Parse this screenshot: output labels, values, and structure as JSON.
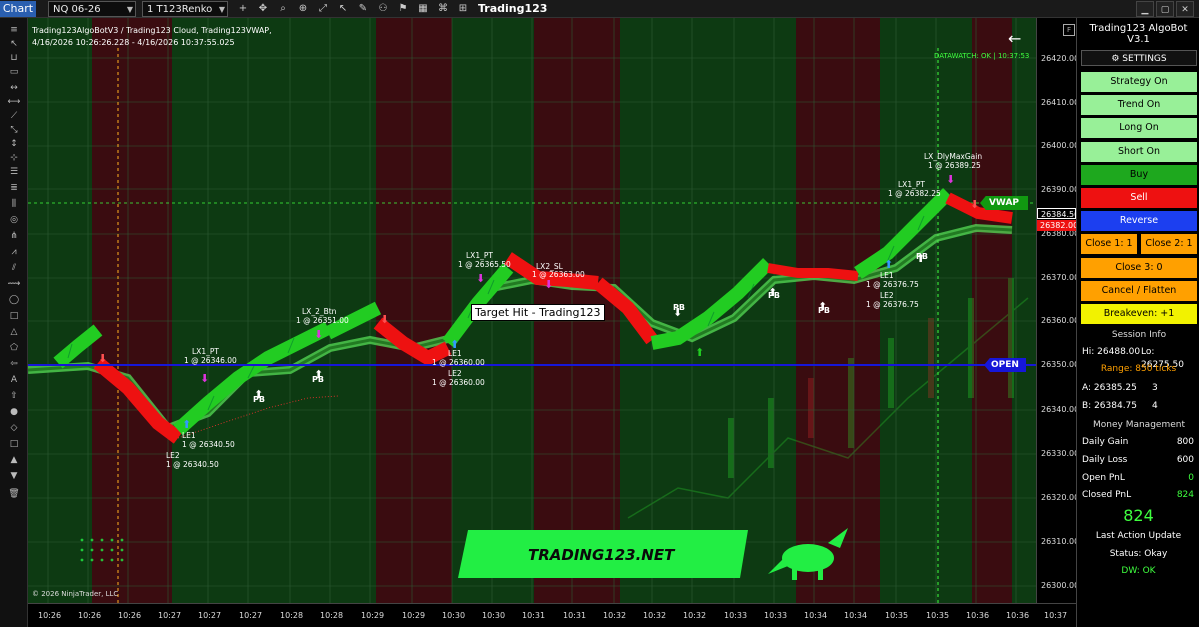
{
  "toolbar": {
    "chart_label": "Chart",
    "instrument": "NQ 06-26",
    "bar_type": "1 T123Renko T...",
    "window_title": "Trading123",
    "tools": [
      "+",
      "✥",
      "⌕",
      "⊕",
      "⤢",
      "↖",
      "✎",
      "⚇",
      "⚑",
      "▦",
      "⌘",
      "⊞",
      "⎘",
      "⚙"
    ]
  },
  "chart": {
    "title_line1": "Trading123AlgoBotV3 / Trading123 Cloud, Trading123VWAP,",
    "title_line2": "4/16/2026 10:26:26.228 - 4/16/2026 10:37:55.025",
    "datawatch": "DATAWATCH: OK | 10:37:53",
    "copyright": "© 2026 NinjaTrader, LLC",
    "target_hit": "Target Hit - Trading123",
    "vwap_tag": "VWAP",
    "open_tag": "OPEN",
    "logo_text": "TRADING123.NET",
    "colors": {
      "bull": "#22cc22",
      "bear": "#ee1111",
      "bg_green": "#0d3a12",
      "bg_red": "#3a0c10",
      "open_line": "#1616d8"
    }
  },
  "annotations": [
    {
      "id": "lx1-a",
      "t1": "LX1_PT",
      "t2": "1 @ 26346.00"
    },
    {
      "id": "le1-a",
      "t1": "LE1",
      "t2": "1 @ 26340.50"
    },
    {
      "id": "le2-a",
      "t1": "LE2",
      "t2": "1 @ 26340.50"
    },
    {
      "id": "lx2-a",
      "t1": "LX_2_Btn",
      "t2": "1 @ 26351.00"
    },
    {
      "id": "le1-b",
      "t1": "LE1",
      "t2": "1 @ 26360.00"
    },
    {
      "id": "le2-b",
      "t1": "LE2",
      "t2": "1 @ 26360.00"
    },
    {
      "id": "lx1-b",
      "t1": "LX1_PT",
      "t2": "1 @ 26365.50"
    },
    {
      "id": "lx2-b",
      "t1": "LX2_SL",
      "t2": "1 @ 26363.00"
    },
    {
      "id": "le1-c",
      "t1": "LE1",
      "t2": "1 @ 26376.75"
    },
    {
      "id": "le2-c",
      "t1": "LE2",
      "t2": "1 @ 26376.75"
    },
    {
      "id": "lx1-c",
      "t1": "LX1_PT",
      "t2": "1 @ 26382.25"
    },
    {
      "id": "lxd-c",
      "t1": "LX_DlyMaxGain",
      "t2": "1 @ 26389.25"
    }
  ],
  "pb_label": "PB",
  "price_axis": {
    "ticks": [
      "26420.00",
      "26410.00",
      "26400.00",
      "26390.00",
      "26380.00",
      "26370.00",
      "26360.00",
      "26350.00",
      "26340.00",
      "26330.00",
      "26320.00",
      "26310.00",
      "26300.00"
    ],
    "last_price": "26384.50",
    "bid_price": "26382.00"
  },
  "time_axis": [
    "10:26",
    "10:26",
    "10:26",
    "10:27",
    "10:27",
    "10:27",
    "10:28",
    "10:28",
    "10:29",
    "10:29",
    "10:30",
    "10:30",
    "10:31",
    "10:31",
    "10:32",
    "10:32",
    "10:32",
    "10:33",
    "10:33",
    "10:34",
    "10:34",
    "10:35",
    "10:35",
    "10:36",
    "10:36",
    "10:37",
    "10:37",
    "10:37"
  ],
  "panel": {
    "title": "Trading123 AlgoBot V3.1",
    "settings": "⚙ SETTINGS",
    "strategy": "Strategy On",
    "trend": "Trend On",
    "long": "Long On",
    "short": "Short On",
    "buy": "Buy",
    "sell": "Sell",
    "reverse": "Reverse",
    "close1": "Close 1:  1",
    "close2": "Close 2:  1",
    "close3": "Close 3:  0",
    "cancel_flatten": "Cancel / Flatten",
    "breakeven": "Breakeven:  +1",
    "session_header": "Session Info",
    "hi": "Hi: 26488.00",
    "lo": "Lo: 26275.50",
    "range": "Range: 850 ticks",
    "a_label": "A: 26385.25",
    "a_val": "3",
    "b_label": "B: 26384.75",
    "b_val": "4",
    "mm_header": "Money Management",
    "daily_gain_label": "Daily Gain",
    "daily_gain": "800",
    "daily_loss_label": "Daily Loss",
    "daily_loss": "600",
    "open_pnl_label": "Open PnL",
    "open_pnl": "0",
    "closed_pnl_label": "Closed PnL",
    "closed_pnl": "824",
    "big_value": "824",
    "last_action": "Last Action Update",
    "status": "Status: Okay",
    "dw": "DW: OK"
  }
}
